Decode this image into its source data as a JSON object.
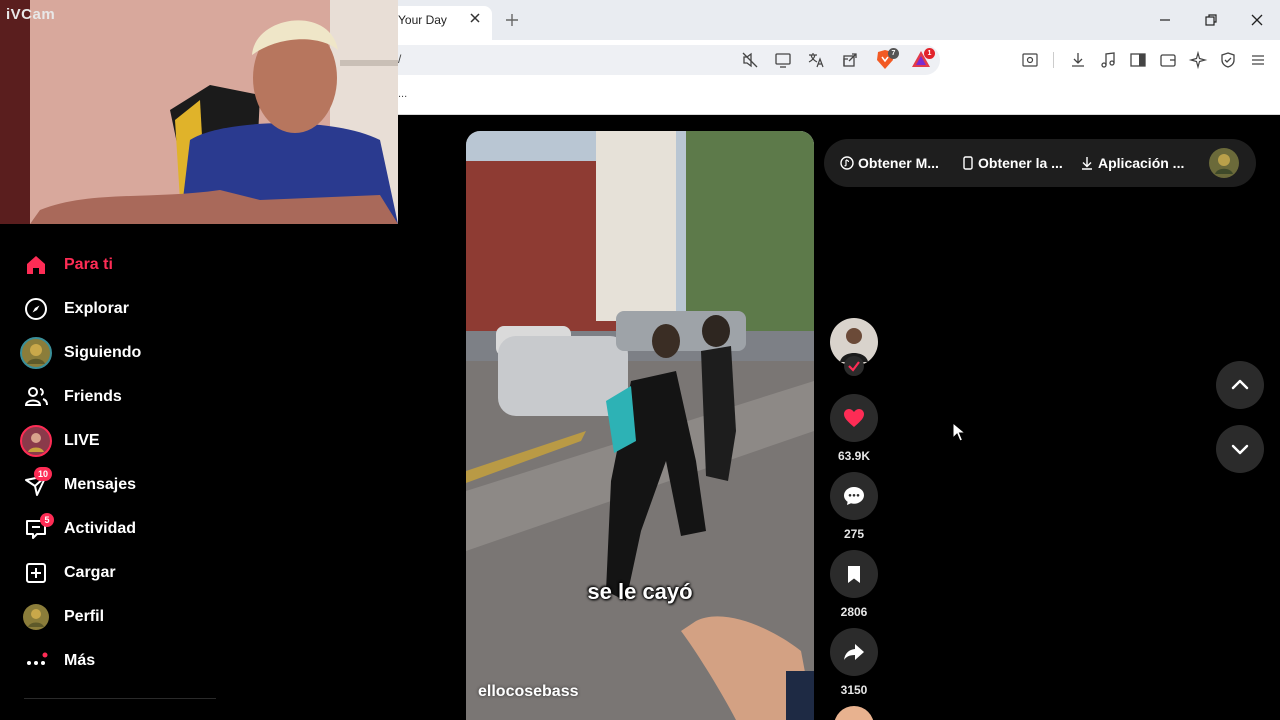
{
  "webcam": {
    "label": "iVCam"
  },
  "browser": {
    "tab_title": "Your Day",
    "url_fragment": "/",
    "bookmarks_overflow": "...",
    "brave_badge": "7",
    "rewards_badge": "1"
  },
  "sidebar": {
    "items": [
      {
        "label": "Para ti",
        "icon": "home-icon"
      },
      {
        "label": "Explorar",
        "icon": "compass-icon"
      },
      {
        "label": "Siguiendo",
        "icon": "following-avatar-icon"
      },
      {
        "label": "Friends",
        "icon": "friends-icon"
      },
      {
        "label": "LIVE",
        "icon": "live-avatar-icon"
      },
      {
        "label": "Mensajes",
        "icon": "messages-icon",
        "badge": "10"
      },
      {
        "label": "Actividad",
        "icon": "activity-icon",
        "badge": "5"
      },
      {
        "label": "Cargar",
        "icon": "upload-icon"
      },
      {
        "label": "Perfil",
        "icon": "profile-avatar-icon"
      },
      {
        "label": "Más",
        "icon": "more-icon"
      }
    ]
  },
  "video": {
    "caption": "se le cayó",
    "author": "ellocosebass"
  },
  "actions": {
    "likes": "63.9K",
    "comments": "275",
    "saves": "2806",
    "shares": "3150"
  },
  "top_pill": {
    "item1": "Obtener M...",
    "item2": "Obtener la ...",
    "item3": "Aplicación ..."
  },
  "colors": {
    "accent": "#fe2c55",
    "background": "#000000",
    "button_bg": "#2b2b2b"
  }
}
